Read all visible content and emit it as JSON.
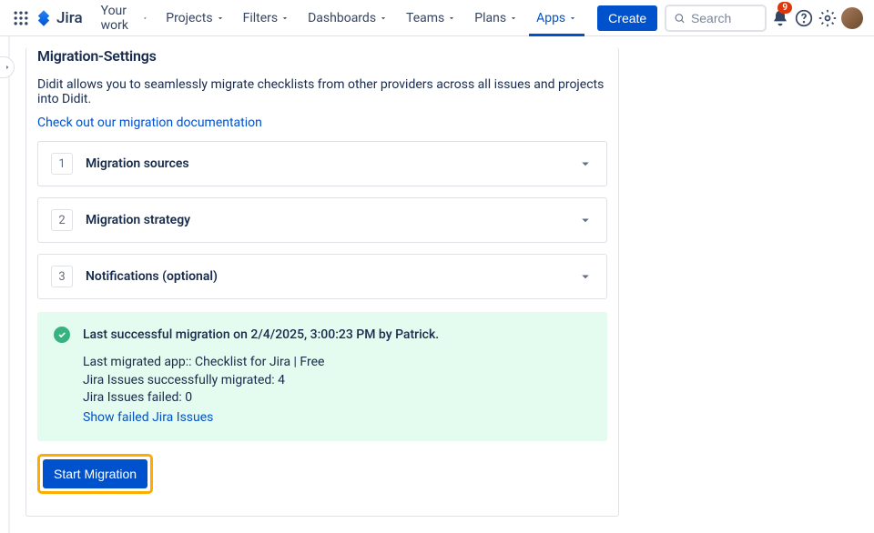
{
  "nav": {
    "logo_text": "Jira",
    "items": [
      "Your work",
      "Projects",
      "Filters",
      "Dashboards",
      "Teams",
      "Plans",
      "Apps"
    ],
    "active_index": 6,
    "create": "Create",
    "search_placeholder": "Search",
    "notif_count": "9"
  },
  "page": {
    "title": "Migration-Settings",
    "desc": "Didit allows you to seamlessly migrate checklists from other providers across all issues and projects into Didit.",
    "doc_link": "Check out our migration documentation"
  },
  "steps": [
    {
      "num": "1",
      "label": "Migration sources"
    },
    {
      "num": "2",
      "label": "Migration strategy"
    },
    {
      "num": "3",
      "label": "Notifications (optional)"
    }
  ],
  "status": {
    "title": "Last successful migration on 2/4/2025, 3:00:23 PM by Patrick.",
    "line1": "Last migrated app:: Checklist for Jira | Free",
    "line2": "Jira Issues successfully migrated: 4",
    "line3": "Jira Issues failed: 0",
    "show_failed": "Show failed Jira Issues"
  },
  "cta": {
    "start": "Start Migration"
  }
}
